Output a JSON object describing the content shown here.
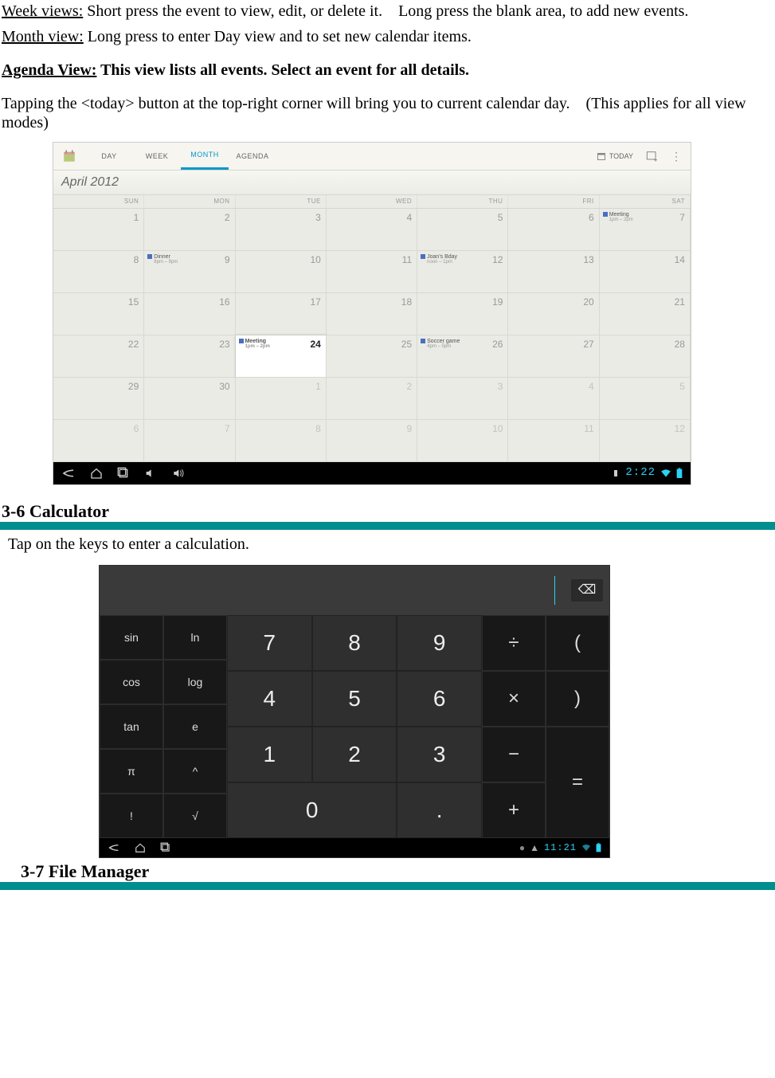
{
  "doc": {
    "week_label": "Week views:",
    "week_text": " Short press the event to view, edit, or delete it. Long press the blank area, to add new events.",
    "month_label": "Month view:",
    "month_text": " Long press to enter Day view and to set new calendar items.",
    "agenda_label": "Agenda View:",
    "agenda_text": " This view lists all events. Select an event for all details.",
    "today_note": "Tapping the <today> button at the top-right corner will bring you to current calendar day. (This applies for all view modes)",
    "sec_calc": "3-6 Calculator",
    "calc_text": "Tap on the keys to enter a calculation.",
    "sec_file": "3-7 File Manager"
  },
  "calendar": {
    "tabs": {
      "day": "DAY",
      "week": "WEEK",
      "month": "MONTH",
      "agenda": "AGENDA"
    },
    "today_label": "TODAY",
    "month_title": "April 2012",
    "dayhead": [
      "SUN",
      "MON",
      "TUE",
      "WED",
      "THU",
      "FRI",
      "SAT"
    ],
    "clock": "2:22",
    "rows": [
      [
        {
          "n": "1"
        },
        {
          "n": "2"
        },
        {
          "n": "3"
        },
        {
          "n": "4"
        },
        {
          "n": "5"
        },
        {
          "n": "6"
        },
        {
          "n": "7",
          "event": {
            "title": "Meeting",
            "time": "1pm – 2pm"
          }
        }
      ],
      [
        {
          "n": "8"
        },
        {
          "n": "9",
          "event": {
            "title": "Dinner",
            "time": "8pm – 9pm"
          }
        },
        {
          "n": "10"
        },
        {
          "n": "11"
        },
        {
          "n": "12",
          "event": {
            "title": "Joan's Bday",
            "time": "noon – 1pm"
          }
        },
        {
          "n": "13"
        },
        {
          "n": "14"
        }
      ],
      [
        {
          "n": "15"
        },
        {
          "n": "16"
        },
        {
          "n": "17"
        },
        {
          "n": "18"
        },
        {
          "n": "19"
        },
        {
          "n": "20"
        },
        {
          "n": "21"
        }
      ],
      [
        {
          "n": "22"
        },
        {
          "n": "23"
        },
        {
          "n": "24",
          "today": true,
          "event": {
            "title": "Meeting",
            "time": "1pm – 2pm"
          }
        },
        {
          "n": "25"
        },
        {
          "n": "26",
          "event": {
            "title": "Soccer game",
            "time": "4pm – 5pm"
          }
        },
        {
          "n": "27"
        },
        {
          "n": "28"
        }
      ],
      [
        {
          "n": "29"
        },
        {
          "n": "30"
        },
        {
          "n": "1",
          "faded": true
        },
        {
          "n": "2",
          "faded": true
        },
        {
          "n": "3",
          "faded": true
        },
        {
          "n": "4",
          "faded": true
        },
        {
          "n": "5",
          "faded": true
        }
      ],
      [
        {
          "n": "6",
          "faded": true
        },
        {
          "n": "7",
          "faded": true
        },
        {
          "n": "8",
          "faded": true
        },
        {
          "n": "9",
          "faded": true
        },
        {
          "n": "10",
          "faded": true
        },
        {
          "n": "11",
          "faded": true
        },
        {
          "n": "12",
          "faded": true
        }
      ]
    ]
  },
  "calculator": {
    "clock": "11:21",
    "sci": [
      "sin",
      "ln",
      "cos",
      "log",
      "tan",
      "e",
      "π",
      "^",
      "!",
      "√"
    ],
    "num_rows": [
      [
        "7",
        "8",
        "9"
      ],
      [
        "4",
        "5",
        "6"
      ],
      [
        "1",
        "2",
        "3"
      ]
    ],
    "zero": "0",
    "dot": ".",
    "ops": {
      "div": "÷",
      "lp": "(",
      "mul": "×",
      "rp": ")",
      "sub": "−",
      "add": "+",
      "eq": "="
    },
    "backspace_glyph": "⌫"
  }
}
